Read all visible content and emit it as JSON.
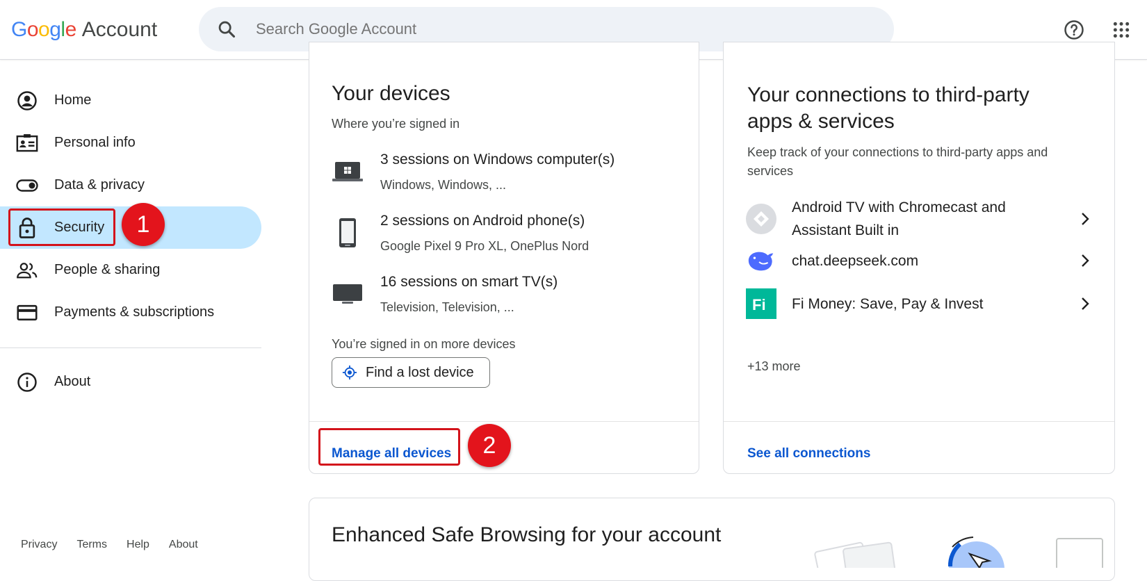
{
  "header": {
    "logo_google": "Google",
    "logo_account": "Account",
    "search_placeholder": "Search Google Account"
  },
  "sidebar": {
    "items": [
      {
        "label": "Home",
        "icon": "account-circle-icon"
      },
      {
        "label": "Personal info",
        "icon": "id-card-icon"
      },
      {
        "label": "Data & privacy",
        "icon": "toggle-icon"
      },
      {
        "label": "Security",
        "icon": "lock-icon",
        "active": true
      },
      {
        "label": "People & sharing",
        "icon": "people-icon"
      },
      {
        "label": "Payments & subscriptions",
        "icon": "credit-card-icon"
      }
    ],
    "about": "About",
    "footer": [
      "Privacy",
      "Terms",
      "Help",
      "About"
    ]
  },
  "callouts": {
    "first": "1",
    "second": "2"
  },
  "devices_card": {
    "title": "Your devices",
    "subtitle": "Where you’re signed in",
    "devices": [
      {
        "title": "3 sessions on Windows computer(s)",
        "detail": "Windows, Windows, ...",
        "icon": "laptop-icon"
      },
      {
        "title": "2 sessions on Android phone(s)",
        "detail": "Google Pixel 9 Pro XL, OnePlus Nord",
        "icon": "phone-icon"
      },
      {
        "title": "16 sessions on smart TV(s)",
        "detail": "Television, Television, ...",
        "icon": "tv-icon"
      }
    ],
    "more_note": "You’re signed in on more devices",
    "find_button": "Find a lost device",
    "manage_link": "Manage all devices"
  },
  "connections_card": {
    "title_line1": "Your connections to third-party",
    "title_line2": "apps & services",
    "subtitle_line1": "Keep track of your connections to third-party apps and",
    "subtitle_line2": "services",
    "apps": [
      {
        "line1": "Android TV with Chromecast and",
        "line2": "Assistant Built in",
        "icon": "android-tv-icon"
      },
      {
        "line1": "chat.deepseek.com",
        "icon": "deepseek-whale-icon"
      },
      {
        "line1": "Fi Money: Save, Pay & Invest",
        "icon": "fi-money-icon"
      }
    ],
    "more": "+13 more",
    "see_all": "See all connections"
  },
  "safe_browsing_card": {
    "title": "Enhanced Safe Browsing for your account"
  },
  "colors": {
    "active_nav": "#c2e7ff",
    "link": "#0b57d0",
    "callout": "#e3141c"
  }
}
